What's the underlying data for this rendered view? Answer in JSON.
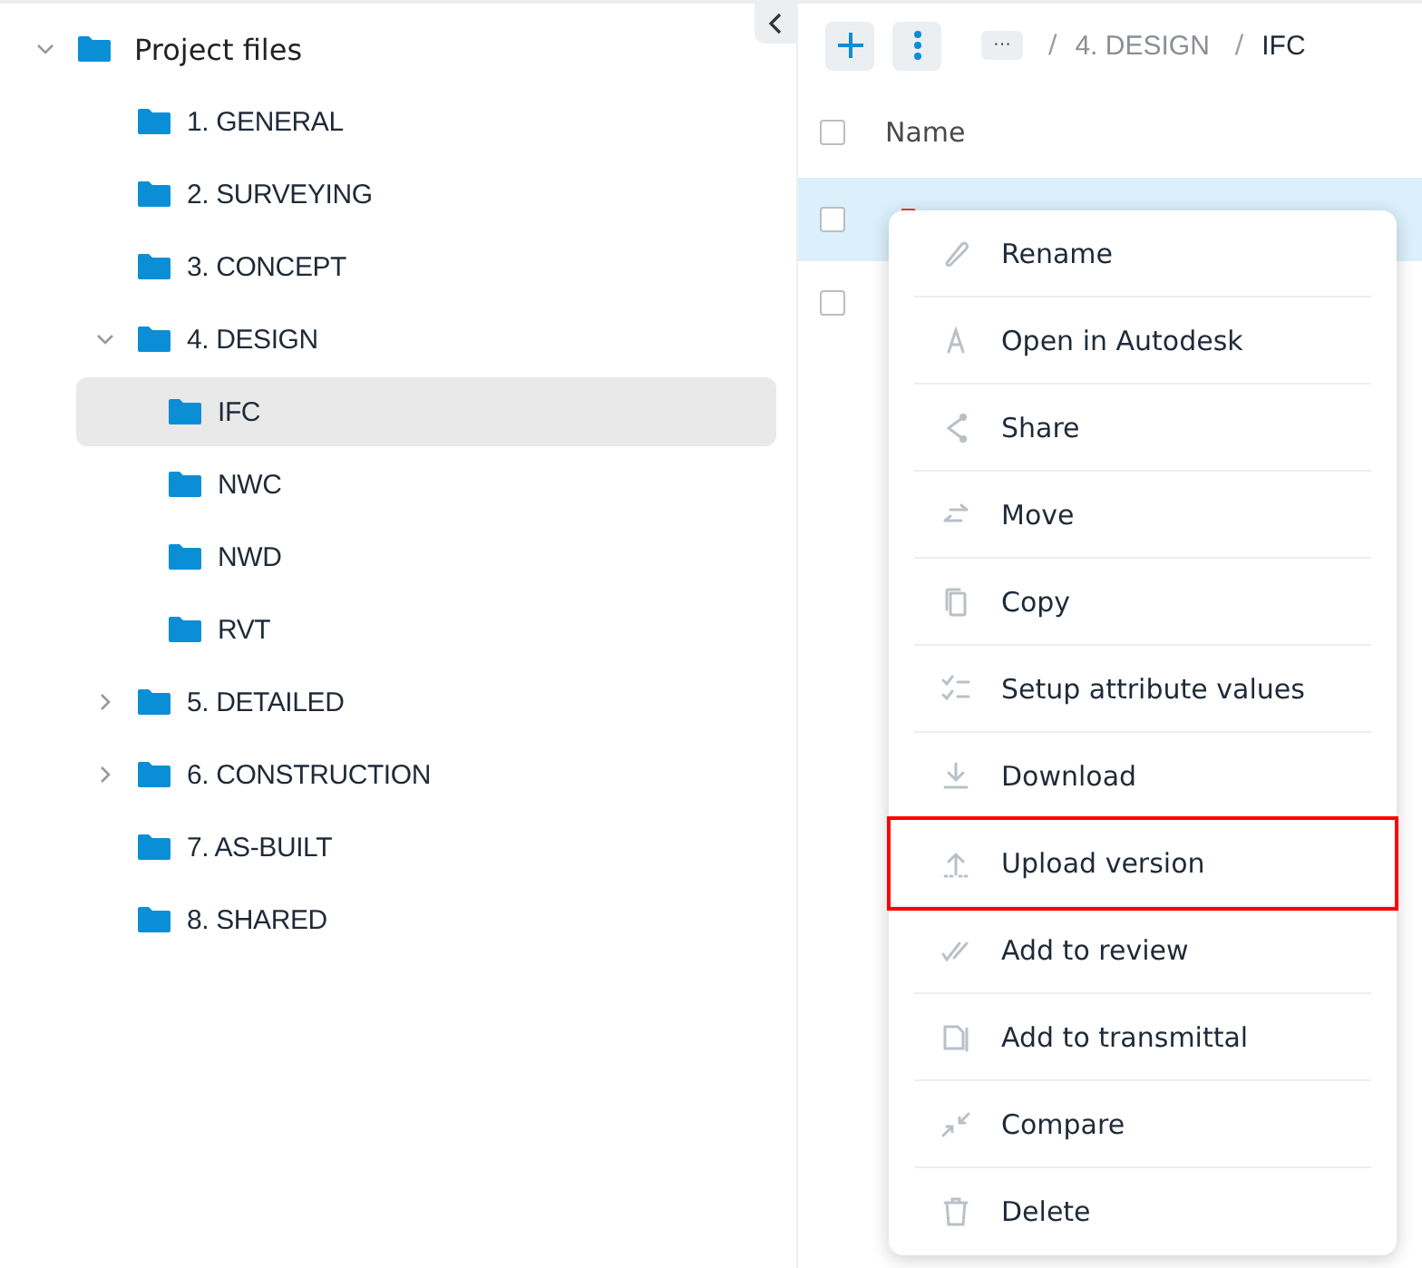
{
  "tree": [
    {
      "label": "Project files",
      "expanded": true,
      "selected": false,
      "children": [
        {
          "label": "1. GENERAL",
          "selected": false
        },
        {
          "label": "2. SURVEYING",
          "selected": false
        },
        {
          "label": "3. CONCEPT",
          "selected": false
        },
        {
          "label": "4. DESIGN",
          "expanded": true,
          "selected": false,
          "children": [
            {
              "label": "IFC",
              "selected": true
            },
            {
              "label": "NWC",
              "selected": false
            },
            {
              "label": "NWD",
              "selected": false
            },
            {
              "label": "RVT",
              "selected": false
            }
          ]
        },
        {
          "label": "5. DETAILED",
          "expanded": false,
          "selected": false
        },
        {
          "label": "6. CONSTRUCTION",
          "expanded": false,
          "selected": false
        },
        {
          "label": "7. AS-BUILT",
          "selected": false
        },
        {
          "label": "8. SHARED",
          "selected": false
        }
      ]
    }
  ],
  "breadcrumb": {
    "more": "···",
    "items": [
      {
        "separator": "/",
        "label": "4. DESIGN"
      },
      {
        "separator": "/",
        "label": "IFC"
      }
    ]
  },
  "table": {
    "select_all_checked": false,
    "columns": [
      "Name"
    ],
    "rows": [
      {
        "selected": true,
        "checked": false
      },
      {
        "selected": false,
        "checked": false
      }
    ]
  },
  "menu": [
    {
      "label": "Rename",
      "highlighted": false
    },
    {
      "label": "Open in Autodesk",
      "highlighted": false
    },
    {
      "label": "Share",
      "highlighted": false
    },
    {
      "label": "Move",
      "highlighted": false
    },
    {
      "label": "Copy",
      "highlighted": false
    },
    {
      "label": "Setup attribute values",
      "highlighted": false
    },
    {
      "label": "Download",
      "highlighted": false
    },
    {
      "label": "Upload version",
      "highlighted": true
    },
    {
      "label": "Add to review",
      "highlighted": false
    },
    {
      "label": "Add to transmittal",
      "highlighted": false
    },
    {
      "label": "Compare",
      "highlighted": false
    },
    {
      "label": "Delete",
      "highlighted": false
    }
  ]
}
